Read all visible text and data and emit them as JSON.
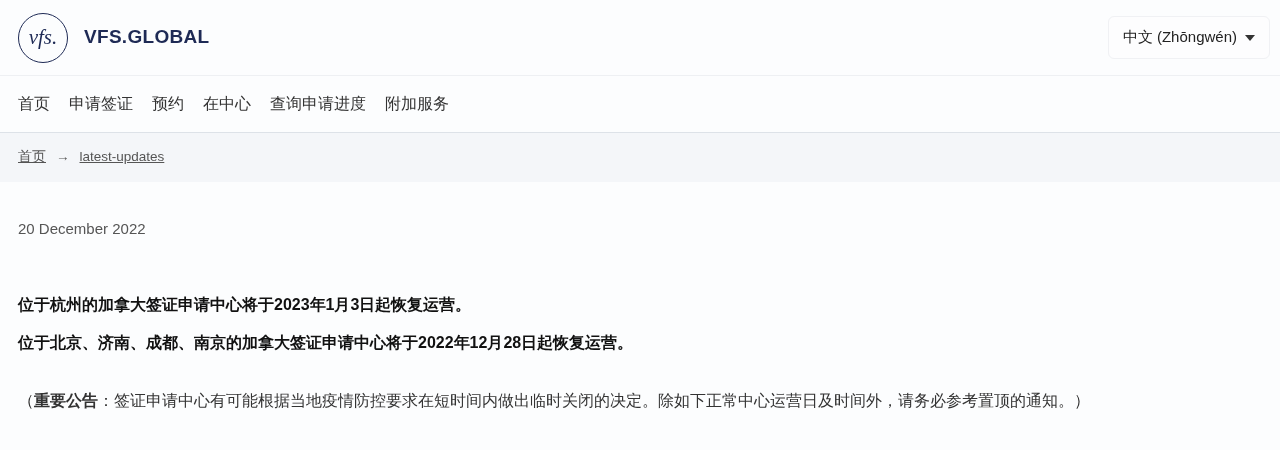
{
  "header": {
    "logo_mark": "vfs.",
    "brand": "VFS.GLOBAL",
    "language_button": "中文 (Zhōngwén)"
  },
  "nav": [
    {
      "label": "首页"
    },
    {
      "label": "申请签证"
    },
    {
      "label": "预约"
    },
    {
      "label": "在中心"
    },
    {
      "label": "查询申请进度"
    },
    {
      "label": "附加服务"
    }
  ],
  "breadcrumb": {
    "items": [
      "首页",
      "latest-updates"
    ],
    "separator": "→"
  },
  "article": {
    "date": "20 December 2022",
    "headlines": [
      "位于杭州的加拿大签证申请中心将于2023年1月3日起恢复运营。",
      "位于北京、济南、成都、南京的加拿大签证申请中心将于2022年12月28日起恢复运营。"
    ],
    "notice": "（**重要公告**：签证申请中心有可能根据当地疫情防控要求在短时间内做出临时关闭的决定。除如下正常中心运营日及时间外，请务必参考置顶的通知。）"
  }
}
